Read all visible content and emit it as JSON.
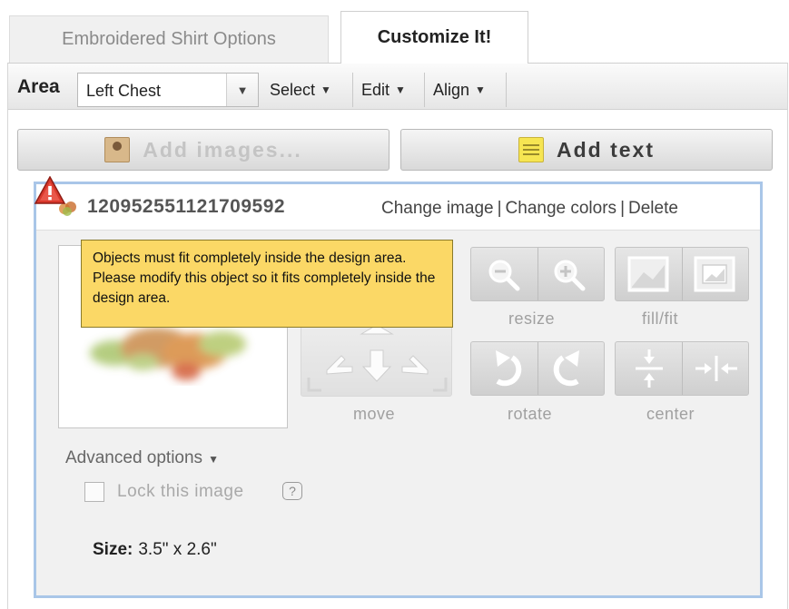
{
  "tabs": [
    {
      "label": "Embroidered Shirt Options",
      "active": false
    },
    {
      "label": "Customize It!",
      "active": true
    }
  ],
  "toolbar": {
    "area_label": "Area",
    "area_value": "Left Chest",
    "select_label": "Select",
    "edit_label": "Edit",
    "align_label": "Align"
  },
  "buttons": {
    "add_images": "Add images...",
    "add_text": "Add text"
  },
  "object": {
    "name": "120952551121709592",
    "change_image": "Change image",
    "change_colors": "Change colors",
    "delete": "Delete",
    "separator": "|",
    "warning": "Objects must fit completely inside the design area. Please modify this object so it fits completely inside the design area.",
    "controls": {
      "resize": "resize",
      "fill_fit": "fill/fit",
      "move": "move",
      "rotate": "rotate",
      "center": "center"
    },
    "advanced_options": "Advanced options",
    "lock_label": "Lock this image",
    "help_glyph": "?",
    "size_label": "Size:",
    "size_value": "3.5\" x 2.6\""
  },
  "icons": {
    "warning": "warning-triangle-icon",
    "zoom_out": "zoom-out-icon",
    "zoom_in": "zoom-in-icon",
    "fill": "fill-icon",
    "fit": "fit-icon",
    "rotate_left": "rotate-left-icon",
    "rotate_right": "rotate-right-icon",
    "center_vertical": "center-vertical-icon",
    "center_horizontal": "center-horizontal-icon"
  },
  "colors": {
    "tooltip_bg": "#fbd866",
    "object_border": "#a9c6e8",
    "warning_red": "#d9382c"
  }
}
